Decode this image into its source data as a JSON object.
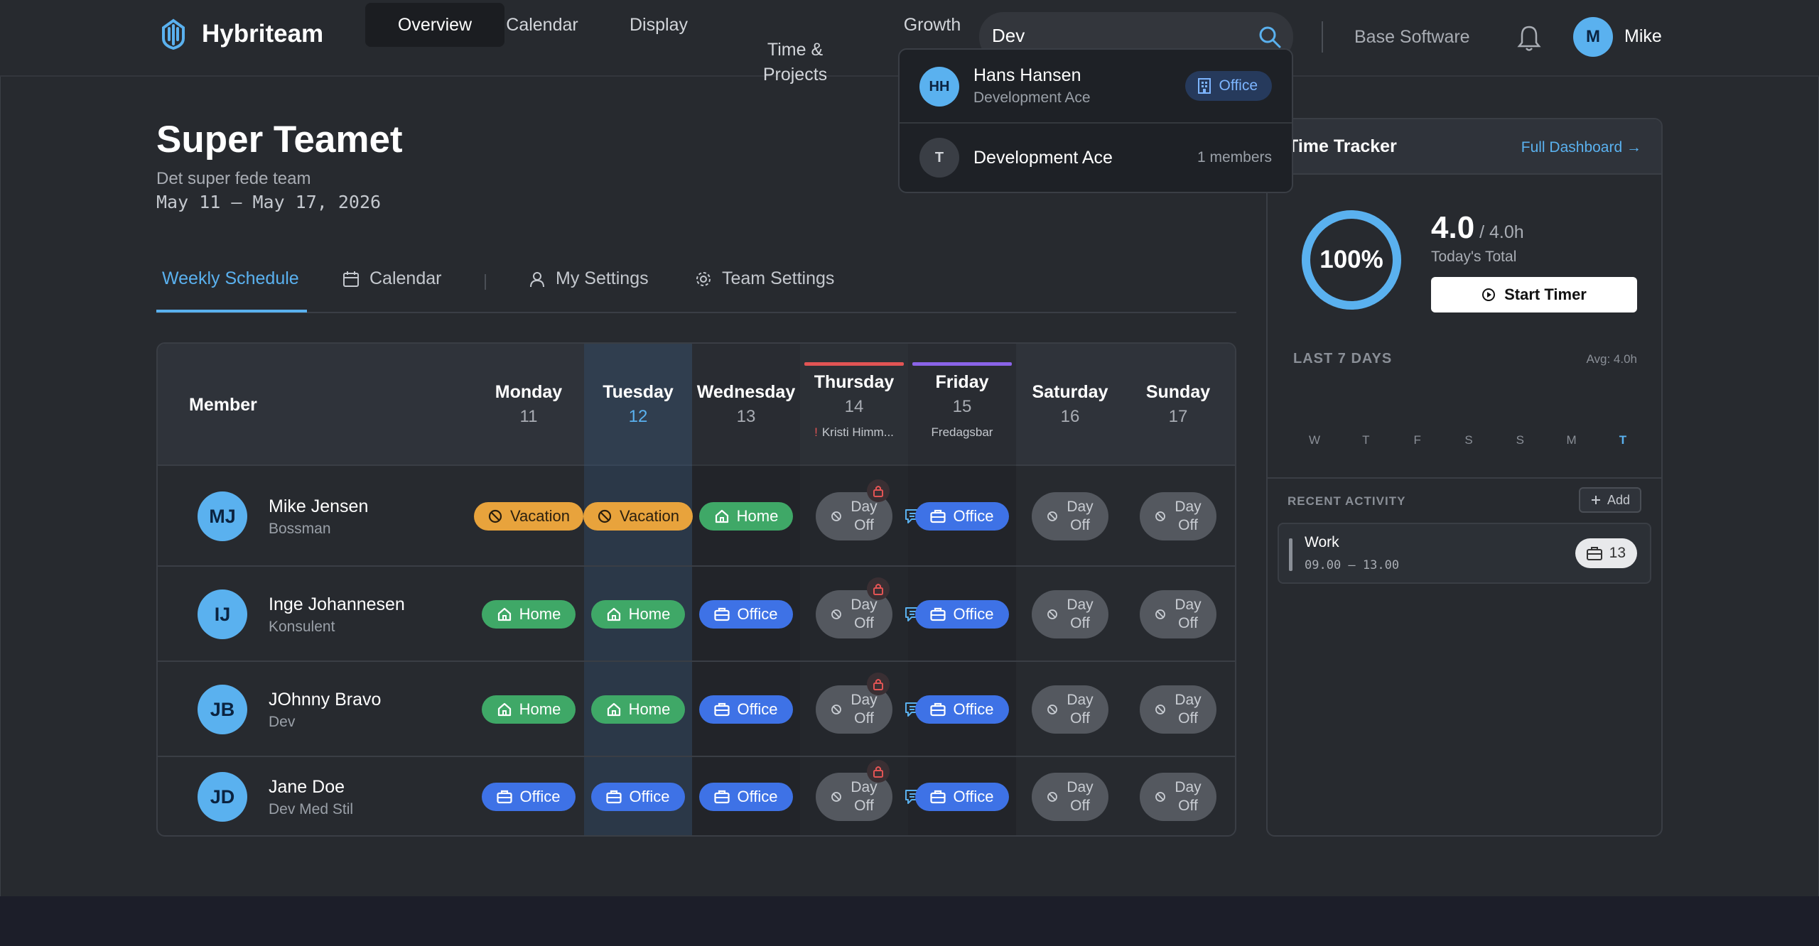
{
  "app": {
    "name": "Hybriteam",
    "company": "Base Software",
    "user_initial": "M",
    "user_name": "Mike"
  },
  "nav": [
    {
      "label": "Overview",
      "active": true
    },
    {
      "label": "Calendar"
    },
    {
      "label": "Display"
    },
    {
      "label": "Time &\nProjects"
    },
    {
      "label": "Growth"
    }
  ],
  "search": {
    "value": "Dev"
  },
  "dropdown": {
    "person": {
      "initials": "HH",
      "name": "Hans Hansen",
      "team": "Development Ace",
      "badge": "Office"
    },
    "team": {
      "initial": "T",
      "name": "Development Ace",
      "members": "1 members"
    }
  },
  "page": {
    "title": "Super Teamet",
    "subtitle": "Det super fede team",
    "range": "May 11 – May 17, 2026"
  },
  "tabs": {
    "weekly": "Weekly Schedule",
    "calendar": "Calendar",
    "my_settings": "My Settings",
    "team_settings": "Team Settings"
  },
  "schedule": {
    "member_header": "Member",
    "days": [
      {
        "name": "Monday",
        "num": "11"
      },
      {
        "name": "Tuesday",
        "num": "12",
        "today": true
      },
      {
        "name": "Wednesday",
        "num": "13"
      },
      {
        "name": "Thursday",
        "num": "14",
        "note_mark": "!",
        "note": "Kristi Himm...",
        "bar_color": "#e25454"
      },
      {
        "name": "Friday",
        "num": "15",
        "note": "Fredagsbar",
        "bar_color": "#8a63e8"
      },
      {
        "name": "Saturday",
        "num": "16"
      },
      {
        "name": "Sunday",
        "num": "17"
      }
    ],
    "rows": [
      {
        "initials": "MJ",
        "name": "Mike Jensen",
        "role": "Bossman",
        "cells": [
          "Vacation",
          "Vacation",
          "Home",
          "Day Off",
          "Office",
          "Day Off",
          "Day Off"
        ]
      },
      {
        "initials": "IJ",
        "name": "Inge Johannesen",
        "role": "Konsulent",
        "cells": [
          "Home",
          "Home",
          "Office",
          "Day Off",
          "Office",
          "Day Off",
          "Day Off"
        ]
      },
      {
        "initials": "JB",
        "name": "JOhnny Bravo",
        "role": "Dev",
        "cells": [
          "Home",
          "Home",
          "Office",
          "Day Off",
          "Office",
          "Day Off",
          "Day Off"
        ]
      },
      {
        "initials": "JD",
        "name": "Jane Doe",
        "role": "Dev Med Stil",
        "cells": [
          "Office",
          "Office",
          "Office",
          "Day Off",
          "Office",
          "Day Off",
          "Day Off"
        ]
      }
    ],
    "labels": {
      "vacation": "Vacation",
      "home": "Home",
      "office": "Office",
      "day": "Day",
      "off": "Off"
    }
  },
  "time_tracker": {
    "title": "Time Tracker",
    "link": "Full Dashboard →",
    "percent": "100%",
    "percent_value": 1.0,
    "hours": "4.0",
    "of_hours": " / 4.0h",
    "total_label": "Today's Total",
    "start_btn": "Start Timer",
    "last7": "LAST 7 DAYS",
    "avg": "Avg: 4.0h",
    "days": [
      "W",
      "T",
      "F",
      "S",
      "S",
      "M",
      "T"
    ],
    "recent_label": "RECENT ACTIVITY",
    "add_label": "Add",
    "activity": {
      "title": "Work",
      "time": "09.00 – 13.00",
      "count": "13"
    }
  },
  "colors": {
    "accent": "#5ab1ef",
    "vacation": "#e8a33c",
    "home": "#3fa867",
    "office": "#3e72e6",
    "day_off": "#54585f"
  }
}
